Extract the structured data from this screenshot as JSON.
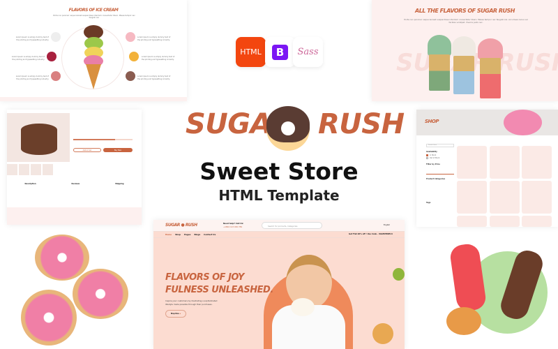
{
  "colors": {
    "brand": "#c8643f",
    "pink_bg": "#fdf0ef",
    "hero_bg": "#fcdcd1",
    "hero_circle": "#ef8a5b"
  },
  "flavors_panel": {
    "title": "FLAVORS OF ICE CREAM",
    "intro": "Porta non pulvinar neque laoreet suspendisse interdum consectetur libero. Massa tempor nec feugiat nisl.",
    "item_desc": "Lorem Ipsum is simply dummy text of the printing and typesetting industry."
  },
  "sugar_panel": {
    "title": "ALL THE FLAVORS OF SUGAR RUSH",
    "intro": "Porta non pulvinar neque laoreet suspendisse interdum consectetur libero. Massa tempor nec feugiat nisl. Accumsan lacus vel facilisis volutpat. Viverra justo nec.",
    "watermark": "SUGAR RUSH"
  },
  "tech_badges": [
    {
      "label": "HTML",
      "icon": "html5-icon"
    },
    {
      "label": "B",
      "icon": "bootstrap-icon"
    },
    {
      "label": "Sass",
      "icon": "sass-icon"
    }
  ],
  "logo": {
    "word1": "SUGAR",
    "word2": "RUSH"
  },
  "headline": {
    "title": "Sweet Store",
    "subtitle": "HTML Template"
  },
  "product_panel": {
    "tabs": [
      "Description",
      "Reviews",
      "Shipping"
    ],
    "add_to_cart": "Add to Cart",
    "buy_now": "Buy Now"
  },
  "shop_panel": {
    "title": "SHOP",
    "search_placeholder": "Search Here",
    "filters": [
      "Availability",
      "Filter by Price",
      "Product Categories",
      "Tags"
    ],
    "stock": [
      "In Stock",
      "Out of Stock"
    ]
  },
  "hero": {
    "help_label": "Need help? Call Us:",
    "phone": "+1804 123 456 789",
    "search_placeholder": "Search for products, Categories",
    "language": "English",
    "nav": [
      "Home",
      "Shop",
      "Pages",
      "Blogs",
      "Contact Us"
    ],
    "promo": "Get Flat 20% off ! Use Code - VALENTINE14",
    "heading_line1": "FLAVORS OF JOY",
    "heading_line2": "FULNESS UNLEASHED.",
    "text": "Inspire your customers by illustrating a sophisticated lifestyle made possible through their purchases.",
    "cta": "Shop Now"
  }
}
